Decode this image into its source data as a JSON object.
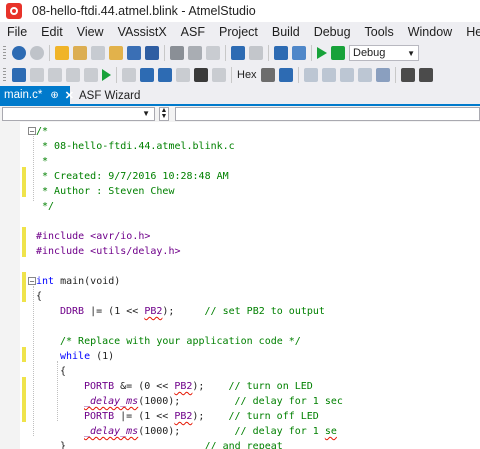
{
  "window": {
    "title": "08-hello-ftdi.44.atmel.blink - AtmelStudio"
  },
  "menu": [
    "File",
    "Edit",
    "View",
    "VAssistX",
    "ASF",
    "Project",
    "Build",
    "Debug",
    "Tools",
    "Window",
    "Help"
  ],
  "toolbar": {
    "config": "Debug",
    "hex_label": "Hex"
  },
  "tabs": {
    "active": "main.c*",
    "pin": "⊕",
    "close": "✕",
    "inactive": "ASF Wizard"
  },
  "code": [
    [
      "/*"
    ],
    [
      " * 08-hello-ftdi.44.atmel.blink.c"
    ],
    [
      " *"
    ],
    [
      " * Created: 9/7/2016 10:28:48 AM"
    ],
    [
      " * Author : Steven Chew"
    ],
    [
      " */"
    ],
    [
      ""
    ],
    [
      "#include <avr/io.h>"
    ],
    [
      "#include <utils/delay.h>"
    ],
    [
      ""
    ],
    [
      "int",
      " main(void)"
    ],
    [
      "{"
    ],
    [
      "DDRB",
      " |= (1 << ",
      "PB2",
      ");",
      "     // set PB2 to output"
    ],
    [
      ""
    ],
    [
      "/* Replace with your application code */"
    ],
    [
      "while",
      " (1)"
    ],
    [
      "{"
    ],
    [
      "PORTB",
      " &= (0 << ",
      "PB2",
      ");",
      "    // turn on LED"
    ],
    [
      "_delay_ms",
      "(1000);",
      "         // delay for 1 sec"
    ],
    [
      "PORTB",
      " |= (1 << ",
      "PB2",
      ");",
      "    // turn off LED"
    ],
    [
      "_delay_ms",
      "(1000);",
      "         // delay for 1 ",
      "se"
    ],
    [
      "}",
      "                       // and repeat"
    ],
    [
      "}"
    ]
  ]
}
